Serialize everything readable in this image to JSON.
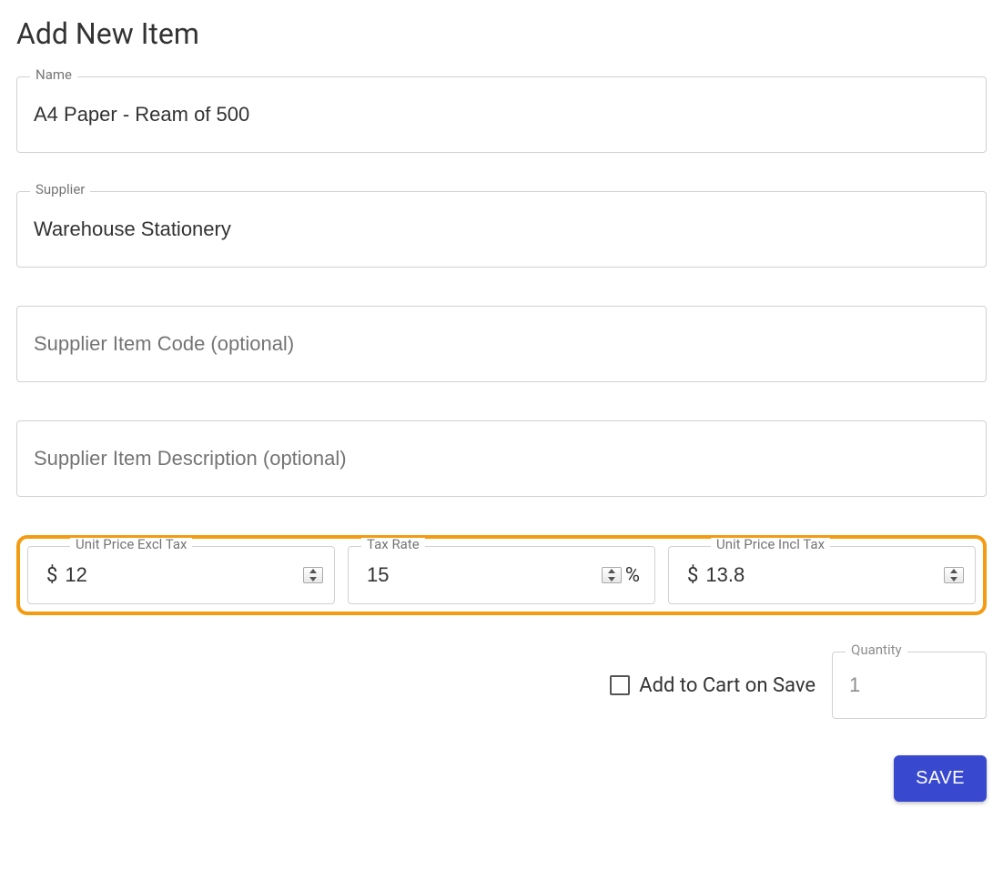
{
  "page": {
    "title": "Add New Item"
  },
  "form": {
    "name": {
      "label": "Name",
      "value": "A4 Paper - Ream of 500"
    },
    "supplier": {
      "label": "Supplier",
      "value": "Warehouse Stationery"
    },
    "supplier_code": {
      "placeholder": "Supplier Item Code (optional)",
      "value": ""
    },
    "supplier_desc": {
      "placeholder": "Supplier Item Description (optional)",
      "value": ""
    },
    "price_excl": {
      "label": "Unit Price Excl Tax",
      "prefix": "$",
      "value": "12"
    },
    "tax_rate": {
      "label": "Tax Rate",
      "suffix": "%",
      "value": "15"
    },
    "price_incl": {
      "label": "Unit Price Incl Tax",
      "prefix": "$",
      "value": "13.8"
    },
    "add_to_cart": {
      "label": "Add to Cart on Save",
      "checked": false
    },
    "quantity": {
      "label": "Quantity",
      "value": "1"
    }
  },
  "actions": {
    "save": "SAVE"
  }
}
